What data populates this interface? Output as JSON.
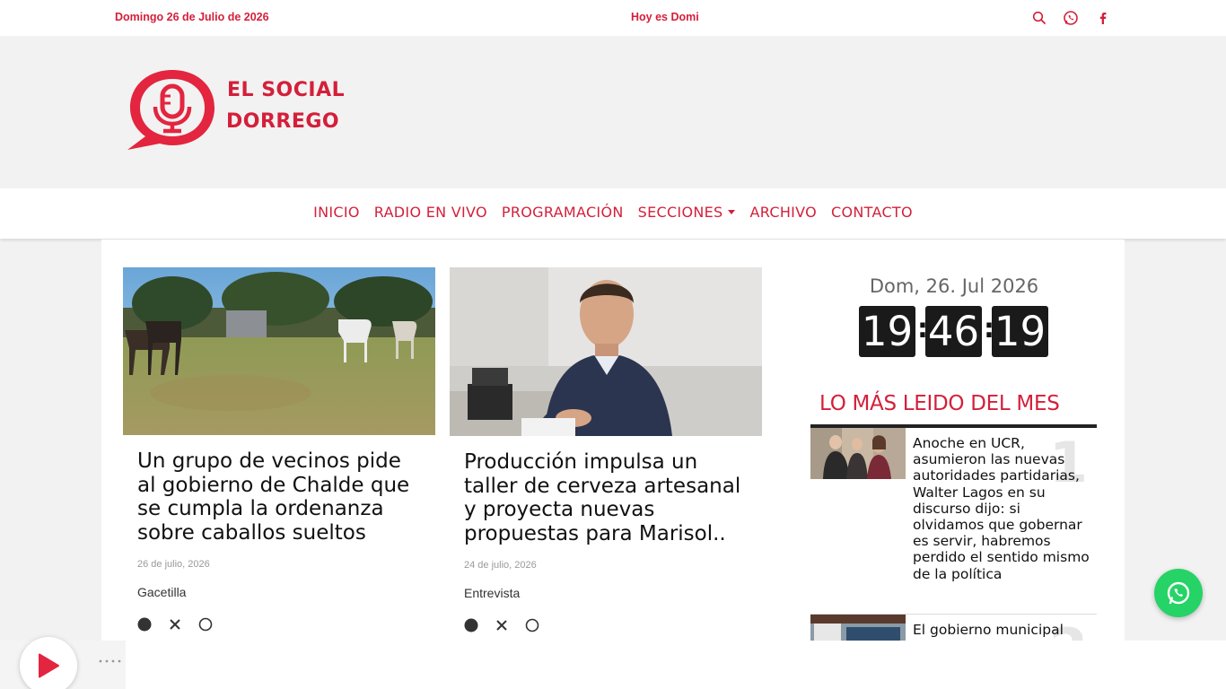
{
  "topbar": {
    "date": "Domingo 26 de Julio de 2026",
    "ticker": "Hoy es Domi",
    "icons": [
      "search-icon",
      "whatsapp-icon",
      "facebook-icon"
    ]
  },
  "logo": {
    "line1": "EL SOCIAL",
    "line2": "DORREGO"
  },
  "nav": {
    "items": [
      "INICIO",
      "RADIO EN VIVO",
      "PROGRAMACIÓN",
      "SECCIONES",
      "ARCHIVO",
      "CONTACTO"
    ]
  },
  "articles": [
    {
      "title": "Un grupo de vecinos pide al gobierno de Chalde que se cumpla la ordenanza sobre caballos sueltos",
      "date": "26 de julio, 2026",
      "category": "Gacetilla"
    },
    {
      "title": "Producción impulsa un taller de cerveza artesanal y proyecta nuevas propuestas para Marisol..",
      "date": "24 de julio, 2026",
      "category": "Entrevista"
    }
  ],
  "sidebar": {
    "date": "Dom, 26. Jul 2026",
    "clock": {
      "h": "19",
      "m": "46",
      "s": "19",
      "sep": ":"
    },
    "mas_leido_title": "LO MÁS LEIDO DEL MES",
    "ranking": [
      {
        "num": "1",
        "text": "Anoche en UCR, asumieron las nuevas autoridades partidarias, Walter Lagos en su discurso dijo: si olvidamos que gobernar es servir, habremos perdido el sentido mismo de la política"
      },
      {
        "num": "2",
        "text": "El gobierno municipal"
      }
    ]
  },
  "colors": {
    "brand": "#d41f3a",
    "whatsapp": "#25d366",
    "clock_bg": "#1a1a1a"
  }
}
